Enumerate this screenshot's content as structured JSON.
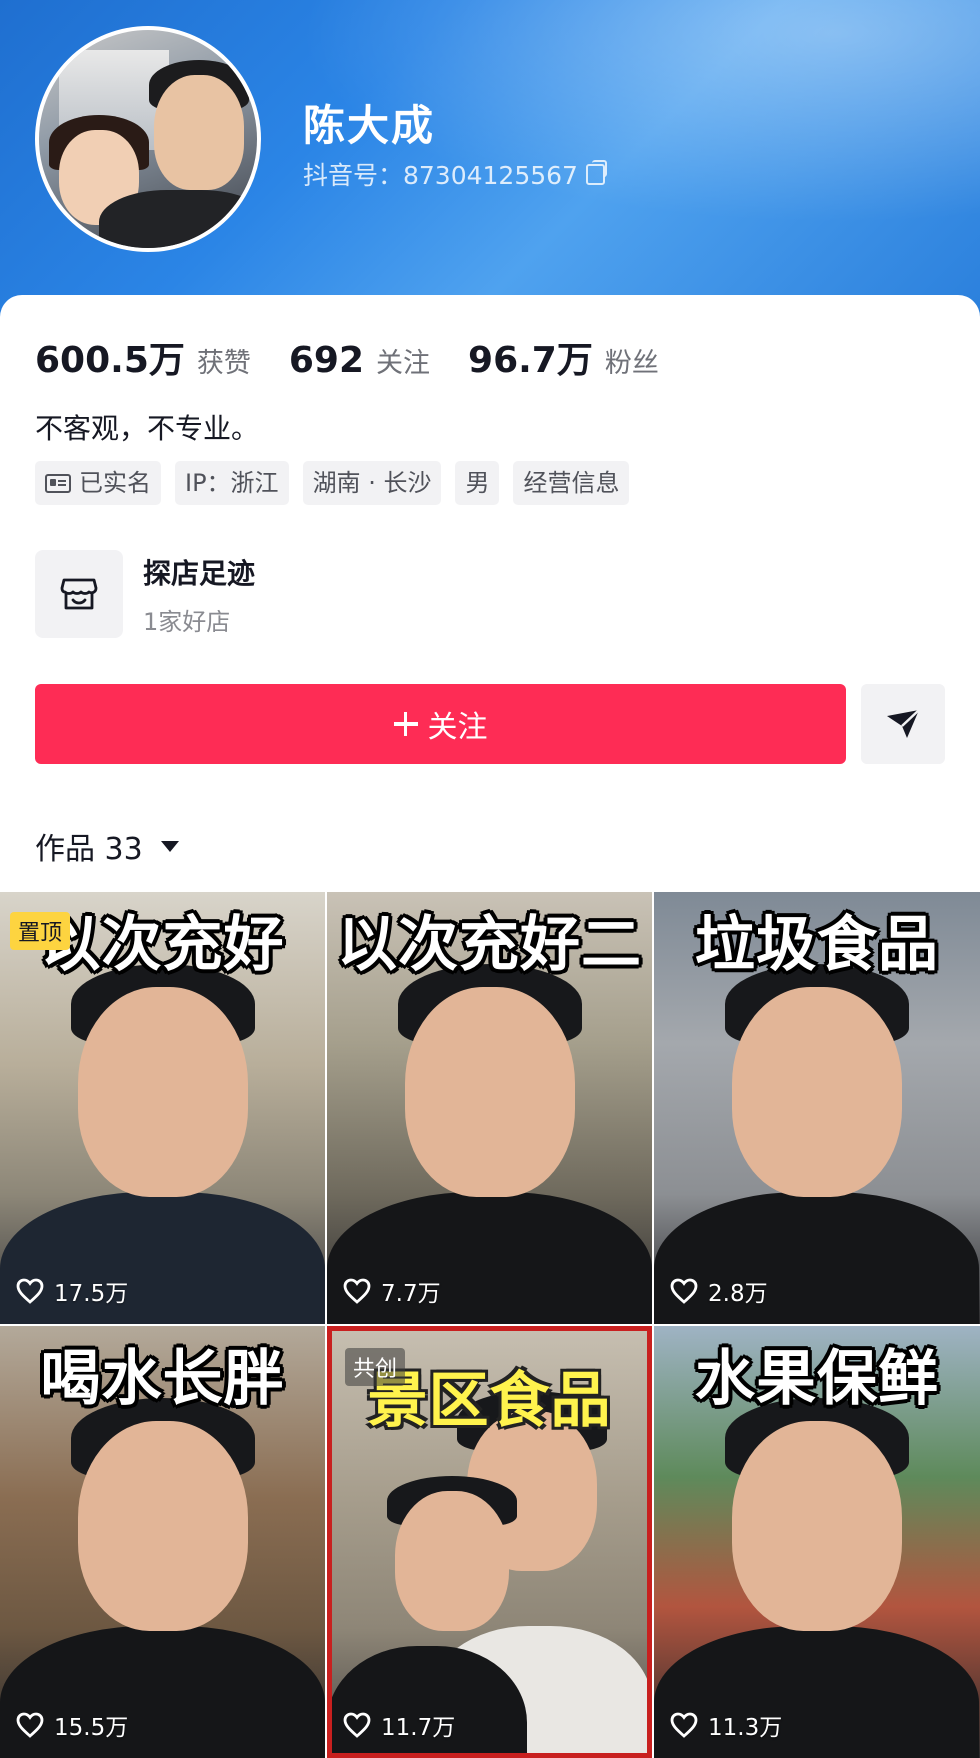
{
  "profile": {
    "name": "陈大成",
    "douyin_id": "抖音号：87304125567",
    "bio": "不客观，不专业。"
  },
  "stats": [
    {
      "value": "600.5万",
      "label": "获赞"
    },
    {
      "value": "692",
      "label": "关注"
    },
    {
      "value": "96.7万",
      "label": "粉丝"
    }
  ],
  "tags": [
    {
      "label": "已实名",
      "icon": "id-card-icon"
    },
    {
      "label": "IP：浙江"
    },
    {
      "label": "湖南 · 长沙"
    },
    {
      "label": "男"
    },
    {
      "label": "经营信息"
    }
  ],
  "shop": {
    "title": "探店足迹",
    "subtitle": "1家好店",
    "icon": "store-icon"
  },
  "actions": {
    "follow_label": "关注",
    "send_icon": "send-icon"
  },
  "works": {
    "label": "作品 33"
  },
  "videos": [
    {
      "title": "以次充好",
      "likes": "17.5万",
      "badge": "置顶"
    },
    {
      "title": "以次充好二",
      "likes": "7.7万"
    },
    {
      "title": "垃圾食品",
      "likes": "2.8万"
    },
    {
      "title": "喝水长胖",
      "likes": "15.5万"
    },
    {
      "title": "景区食品",
      "likes": "11.7万",
      "badge": "共创"
    },
    {
      "title": "水果保鲜",
      "likes": "11.3万"
    }
  ],
  "colors": {
    "accent": "#fe2c55",
    "header_blue": "#2b85e6",
    "pin_badge": "#fdd440",
    "co_frame": "#c8201f"
  }
}
